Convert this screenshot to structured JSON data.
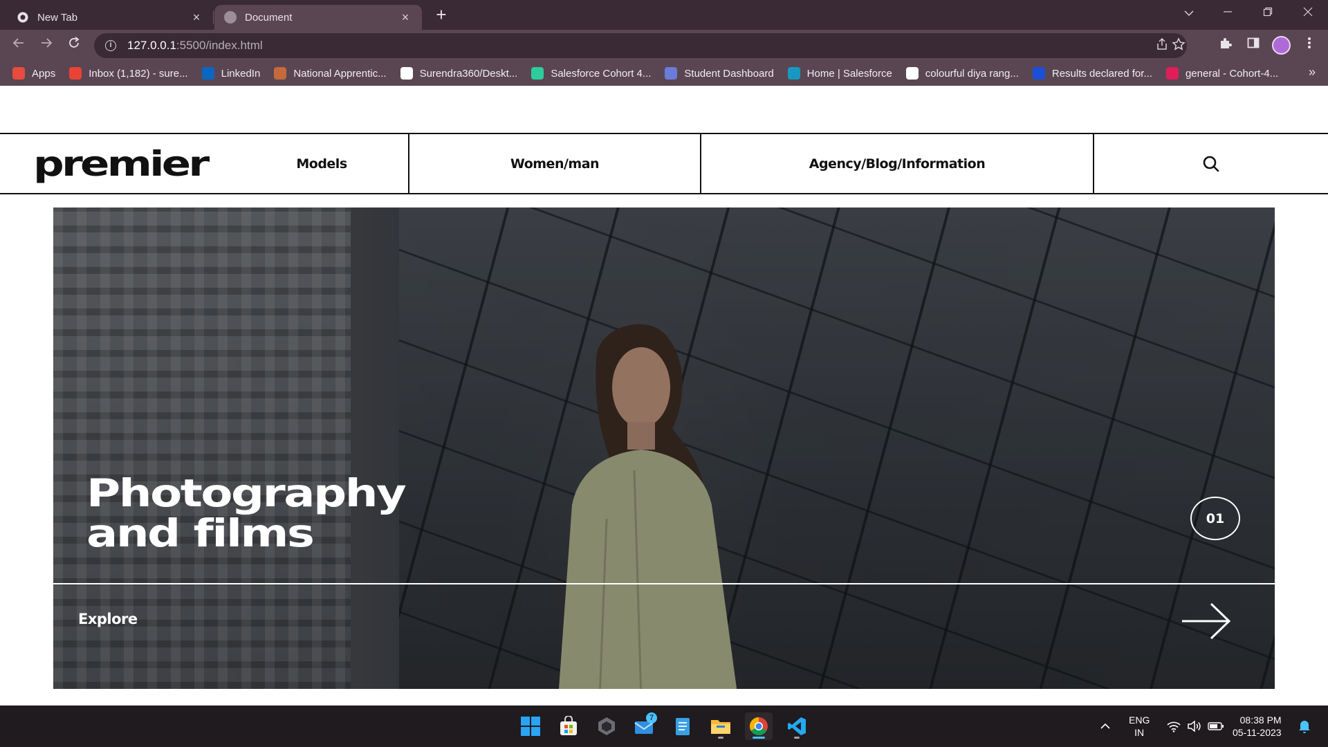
{
  "browser": {
    "tabs": [
      {
        "title": "New Tab"
      },
      {
        "title": "Document"
      }
    ],
    "close_glyph": "×",
    "new_tab_glyph": "+",
    "url": {
      "host": "127.0.0.1",
      "path": ":5500/index.html"
    },
    "bookmarks": [
      {
        "label": "Apps",
        "icon": "apps-grid-icon",
        "color": "#e84c3d"
      },
      {
        "label": "Inbox (1,182) - sure...",
        "icon": "gmail-icon",
        "color": "#ea4335"
      },
      {
        "label": "LinkedIn",
        "icon": "linkedin-icon",
        "color": "#0a66c2"
      },
      {
        "label": "National Apprentic...",
        "icon": "national-apprenticeship-icon",
        "color": "#c46a3c"
      },
      {
        "label": "Surendra360/Deskt...",
        "icon": "github-icon",
        "color": "#ffffff"
      },
      {
        "label": "Salesforce Cohort 4...",
        "icon": "trailhead-icon",
        "color": "#2ecc9a"
      },
      {
        "label": "Student Dashboard",
        "icon": "student-dashboard-icon",
        "color": "#6b7bd8"
      },
      {
        "label": "Home | Salesforce",
        "icon": "salesforce-cloud-icon",
        "color": "#1798c1"
      },
      {
        "label": "colourful diya rang...",
        "icon": "globe-icon",
        "color": "#ffffff"
      },
      {
        "label": "Results declared for...",
        "icon": "unstop-icon",
        "color": "#1c4fd8"
      },
      {
        "label": "general - Cohort-4...",
        "icon": "slack-icon",
        "color": "#e01e5a"
      }
    ],
    "bookmarks_more": "»"
  },
  "site": {
    "logo": "premier",
    "nav": {
      "models": "Models",
      "women_man": "Women/man",
      "agency": "Agency/Blog/Information",
      "search_icon": "search-icon"
    },
    "hero": {
      "title_line1": "Photography",
      "title_line2": "and films",
      "slide_number": "01",
      "cta": "Explore",
      "cta_icon": "arrow-right-icon"
    }
  },
  "taskbar": {
    "apps": [
      {
        "name": "start",
        "icon": "windows-start-icon"
      },
      {
        "name": "store",
        "icon": "microsoft-store-icon"
      },
      {
        "name": "app",
        "icon": "hexagon-app-icon"
      },
      {
        "name": "mail",
        "icon": "mail-icon",
        "badge": "7"
      },
      {
        "name": "notepad",
        "icon": "notepad-icon"
      },
      {
        "name": "explorer",
        "icon": "file-explorer-icon"
      },
      {
        "name": "chrome",
        "icon": "chrome-icon"
      },
      {
        "name": "vscode",
        "icon": "vscode-icon"
      }
    ],
    "language": {
      "line1": "ENG",
      "line2": "IN"
    },
    "time": "08:38 PM",
    "date": "05-11-2023"
  },
  "colors": {
    "chrome_dark": "#3a2a35",
    "chrome_toolbar": "#5a4652",
    "page_bg": "#ffffff",
    "ink": "#111111",
    "taskbar": "#1f1b1e",
    "accent_blue": "#4cc2ff"
  }
}
